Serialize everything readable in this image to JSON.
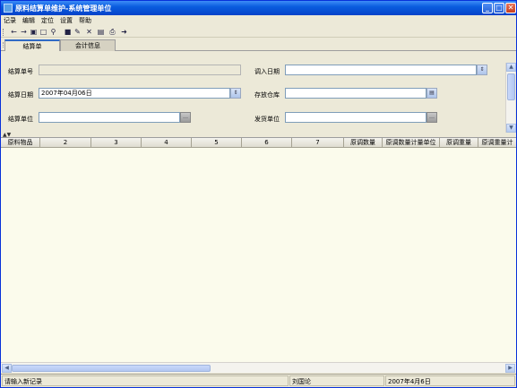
{
  "window": {
    "title": "原料结算单维护-系统管理单位"
  },
  "menu": [
    "记录",
    "编辑",
    "定位",
    "设置",
    "帮助"
  ],
  "toolbar": [
    {
      "icon": "back-arrow-icon",
      "glyph": "←"
    },
    {
      "icon": "forward-arrow-icon",
      "glyph": "→"
    },
    {
      "icon": "preview-icon",
      "glyph": "▣"
    },
    {
      "icon": "new-document-icon",
      "glyph": "□"
    },
    {
      "icon": "search-icon",
      "glyph": "⚲"
    },
    {
      "icon": "save-icon",
      "glyph": "■"
    },
    {
      "icon": "edit-icon",
      "glyph": "✎"
    },
    {
      "icon": "delete-icon",
      "glyph": "✕"
    },
    {
      "icon": "chart-icon",
      "glyph": "▤"
    },
    {
      "icon": "print-icon",
      "glyph": "⎙"
    },
    {
      "icon": "exit-icon",
      "glyph": "➜"
    }
  ],
  "tabs": {
    "active": "结算单",
    "inactive": "会计信息"
  },
  "form": {
    "settlement_no_label": "结算单号",
    "settlement_no_value": "",
    "transfer_date_label": "调入日期",
    "transfer_date_value": "",
    "settlement_date_label": "结算日期",
    "settlement_date_value": "2007年04月06日",
    "warehouse_label": "存放仓库",
    "warehouse_value": "",
    "settlement_unit_label": "结算单位",
    "settlement_unit_value": "",
    "shipping_unit_label": "发货单位",
    "shipping_unit_value": ""
  },
  "grid": {
    "columns": [
      "原料物品",
      "2",
      "3",
      "4",
      "5",
      "6",
      "7",
      "原调数量",
      "原调数量计量单位",
      "原调重量",
      "原调重量计"
    ],
    "rows": []
  },
  "status": {
    "message": "请输入新记录",
    "user": "刘国论",
    "date": "2007年4月6日"
  }
}
